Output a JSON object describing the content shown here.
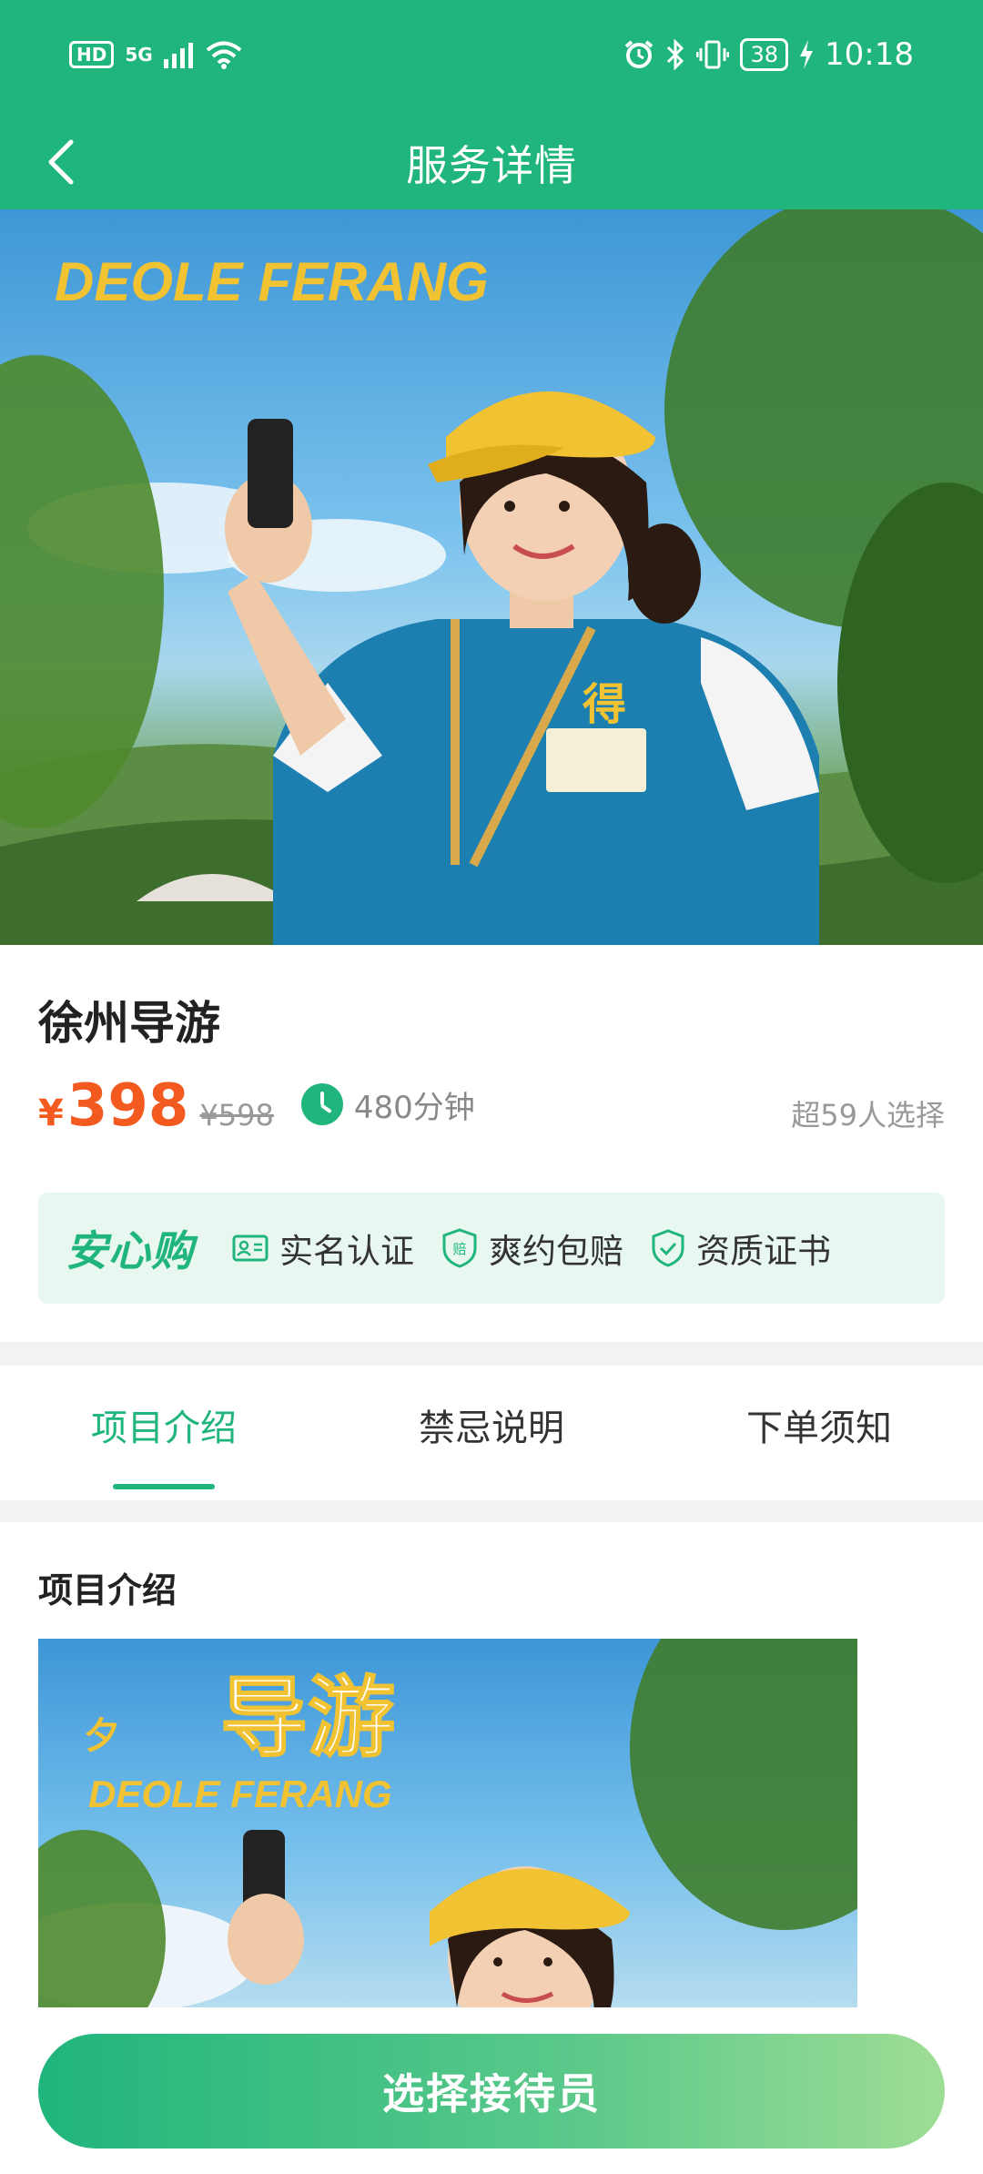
{
  "status_bar": {
    "hd": "HD",
    "network": "5G",
    "battery": "38",
    "time": "10:18"
  },
  "nav": {
    "title": "服务详情"
  },
  "hero": {
    "banner_text": "DEOLE FERANG",
    "badge_text": "得"
  },
  "service": {
    "name": "徐州导游",
    "currency": "¥",
    "price": "398",
    "original_price": "¥598",
    "duration": "480分钟",
    "selected_count": "超59人选择"
  },
  "assurance": {
    "logo": "安心购",
    "items": [
      {
        "label": "实名认证",
        "icon": "id-card-icon"
      },
      {
        "label": "爽约包赔",
        "icon": "compensation-shield-icon"
      },
      {
        "label": "资质证书",
        "icon": "certificate-shield-icon"
      }
    ]
  },
  "tabs": [
    {
      "label": "项目介绍",
      "active": true
    },
    {
      "label": "禁忌说明",
      "active": false
    },
    {
      "label": "下单须知",
      "active": false
    }
  ],
  "intro": {
    "heading": "项目介绍",
    "image_title": "导游",
    "image_subtitle": "DEOLE FERANG"
  },
  "cta": {
    "label": "选择接待员"
  },
  "colors": {
    "brand_green": "#20b57c",
    "price_orange": "#f25a1f"
  }
}
